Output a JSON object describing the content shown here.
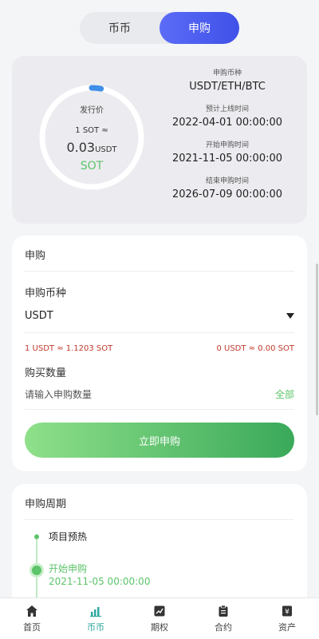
{
  "tabs": [
    {
      "label": "币币",
      "active": false
    },
    {
      "label": "申购",
      "active": true
    }
  ],
  "info": {
    "ring_label": "发行价",
    "rate_line": "1 SOT ≈",
    "price_value": "0.03",
    "price_unit": "USDT",
    "coin": "SOT",
    "progress_percent": 3,
    "items": [
      {
        "label": "申购币种",
        "value": "USDT/ETH/BTC"
      },
      {
        "label": "预计上线时间",
        "value": "2022-04-01 00:00:00"
      },
      {
        "label": "开始申购时间",
        "value": "2021-11-05 00:00:00"
      },
      {
        "label": "结束申购时间",
        "value": "2026-07-09 00:00:00"
      }
    ]
  },
  "subscribe": {
    "title": "申购",
    "currency_label": "申购币种",
    "currency_value": "USDT",
    "rate_left": "1 USDT ≈ 1.1203 SOT",
    "rate_right": "0 USDT ≈ 0.00 SOT",
    "qty_label": "购买数量",
    "qty_placeholder": "请输入申购数量",
    "all_label": "全部",
    "submit_label": "立即申购"
  },
  "period": {
    "title": "申购周期",
    "steps": [
      {
        "label": "项目预热"
      },
      {
        "label": "开始申购",
        "time": "2021-11-05 00:00:00"
      }
    ]
  },
  "nav": [
    {
      "label": "首页",
      "icon": "home-icon",
      "active": false
    },
    {
      "label": "币币",
      "icon": "bar-chart-icon",
      "active": true
    },
    {
      "label": "期权",
      "icon": "trend-icon",
      "active": false
    },
    {
      "label": "合约",
      "icon": "clipboard-icon",
      "active": false
    },
    {
      "label": "资产",
      "icon": "wallet-icon",
      "active": false
    }
  ],
  "colors": {
    "accent_blue": "#4a5cf0",
    "accent_green": "#5cc46a",
    "rate_red": "#c0392b",
    "nav_active": "#2fa8a0"
  }
}
